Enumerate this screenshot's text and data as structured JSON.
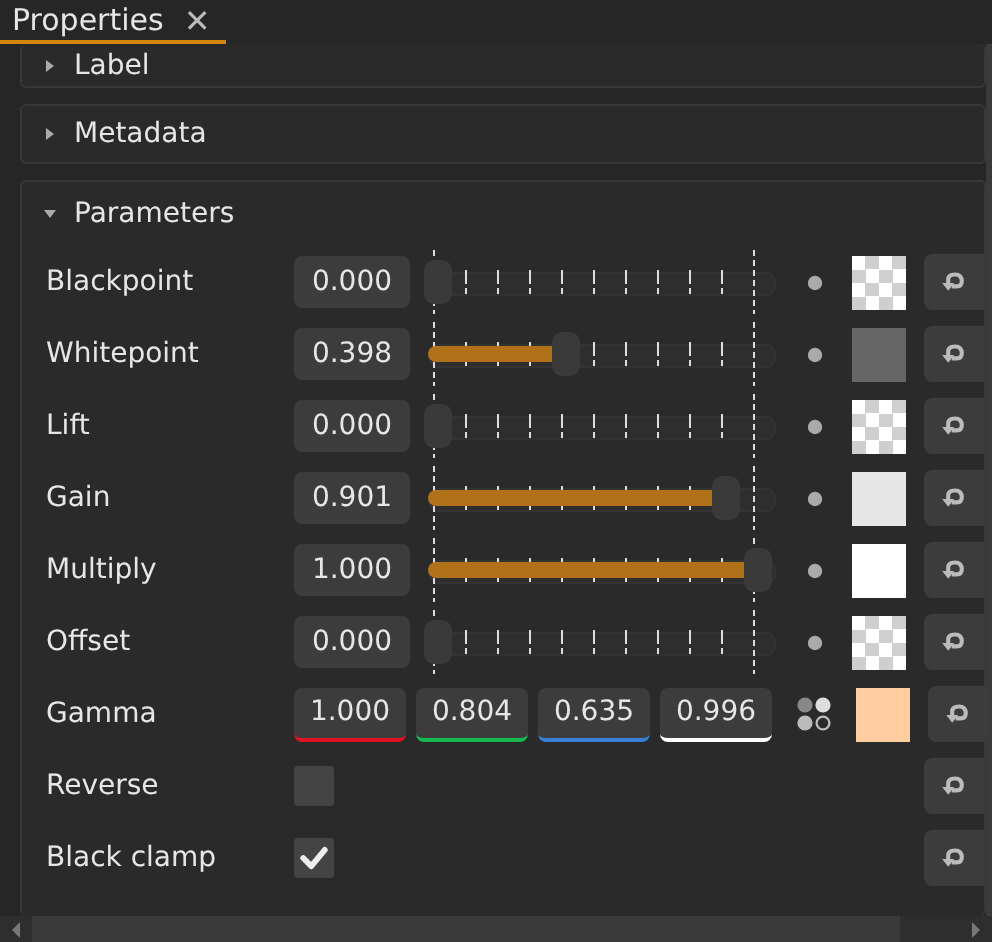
{
  "tab": {
    "title": "Properties",
    "close": "✕",
    "selected": true
  },
  "sections": [
    {
      "title": "Label",
      "expanded": false
    },
    {
      "title": "Metadata",
      "expanded": false
    }
  ],
  "parameters": {
    "title": "Parameters",
    "expanded": true,
    "rows": [
      {
        "kind": "slider",
        "label": "Blackpoint",
        "value": "0.000",
        "level": 0.0
      },
      {
        "kind": "slider",
        "label": "Whitepoint",
        "value": "0.398",
        "level": 0.398,
        "color": "#666666"
      },
      {
        "kind": "slider",
        "label": "Lift",
        "value": "0.000",
        "level": 0.0
      },
      {
        "kind": "slider",
        "label": "Gain",
        "value": "0.901",
        "level": 0.901,
        "color": "#e6e6e6"
      },
      {
        "kind": "slider",
        "label": "Multiply",
        "value": "1.000",
        "level": 1.0,
        "color": "#ffffff"
      },
      {
        "kind": "slider",
        "label": "Offset",
        "value": "0.000",
        "level": 0.0
      },
      {
        "kind": "channels",
        "label": "Gamma",
        "color": "#ffcd9f",
        "channels": [
          {
            "value": "1.000",
            "color": "#e0141e"
          },
          {
            "value": "0.804",
            "color": "#17b84f"
          },
          {
            "value": "0.635",
            "color": "#3a7fd6"
          },
          {
            "value": "0.996",
            "color": "#ffffff"
          }
        ]
      },
      {
        "kind": "checkbox",
        "label": "Reverse",
        "checked": false
      },
      {
        "kind": "checkbox",
        "label": "Black clamp",
        "checked": true
      }
    ]
  }
}
